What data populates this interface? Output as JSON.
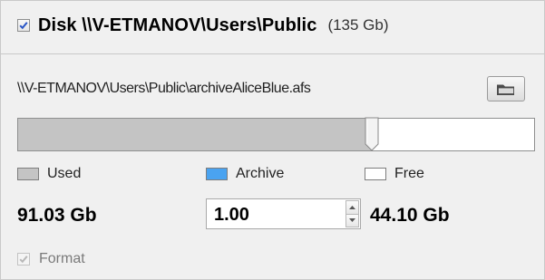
{
  "header": {
    "enabled": true,
    "title": "Disk \\\\V-ETMANOV\\Users\\Public",
    "size": "(135 Gb)"
  },
  "path": {
    "value": "\\\\V-ETMANOV\\Users\\Public\\archiveAliceBlue.afs",
    "browse_icon": "folder-icon"
  },
  "allocation": {
    "used_fraction": 0.6849
  },
  "legend": {
    "used": {
      "label": "Used",
      "color": "#c4c4c4"
    },
    "archive": {
      "label": "Archive",
      "color": "#4aa3f0"
    },
    "free": {
      "label": "Free",
      "color": "#ffffff"
    }
  },
  "values": {
    "used": "91.03 Gb",
    "archive": "1.00",
    "free": "44.10 Gb"
  },
  "format": {
    "label": "Format",
    "checked": true,
    "disabled": true
  }
}
